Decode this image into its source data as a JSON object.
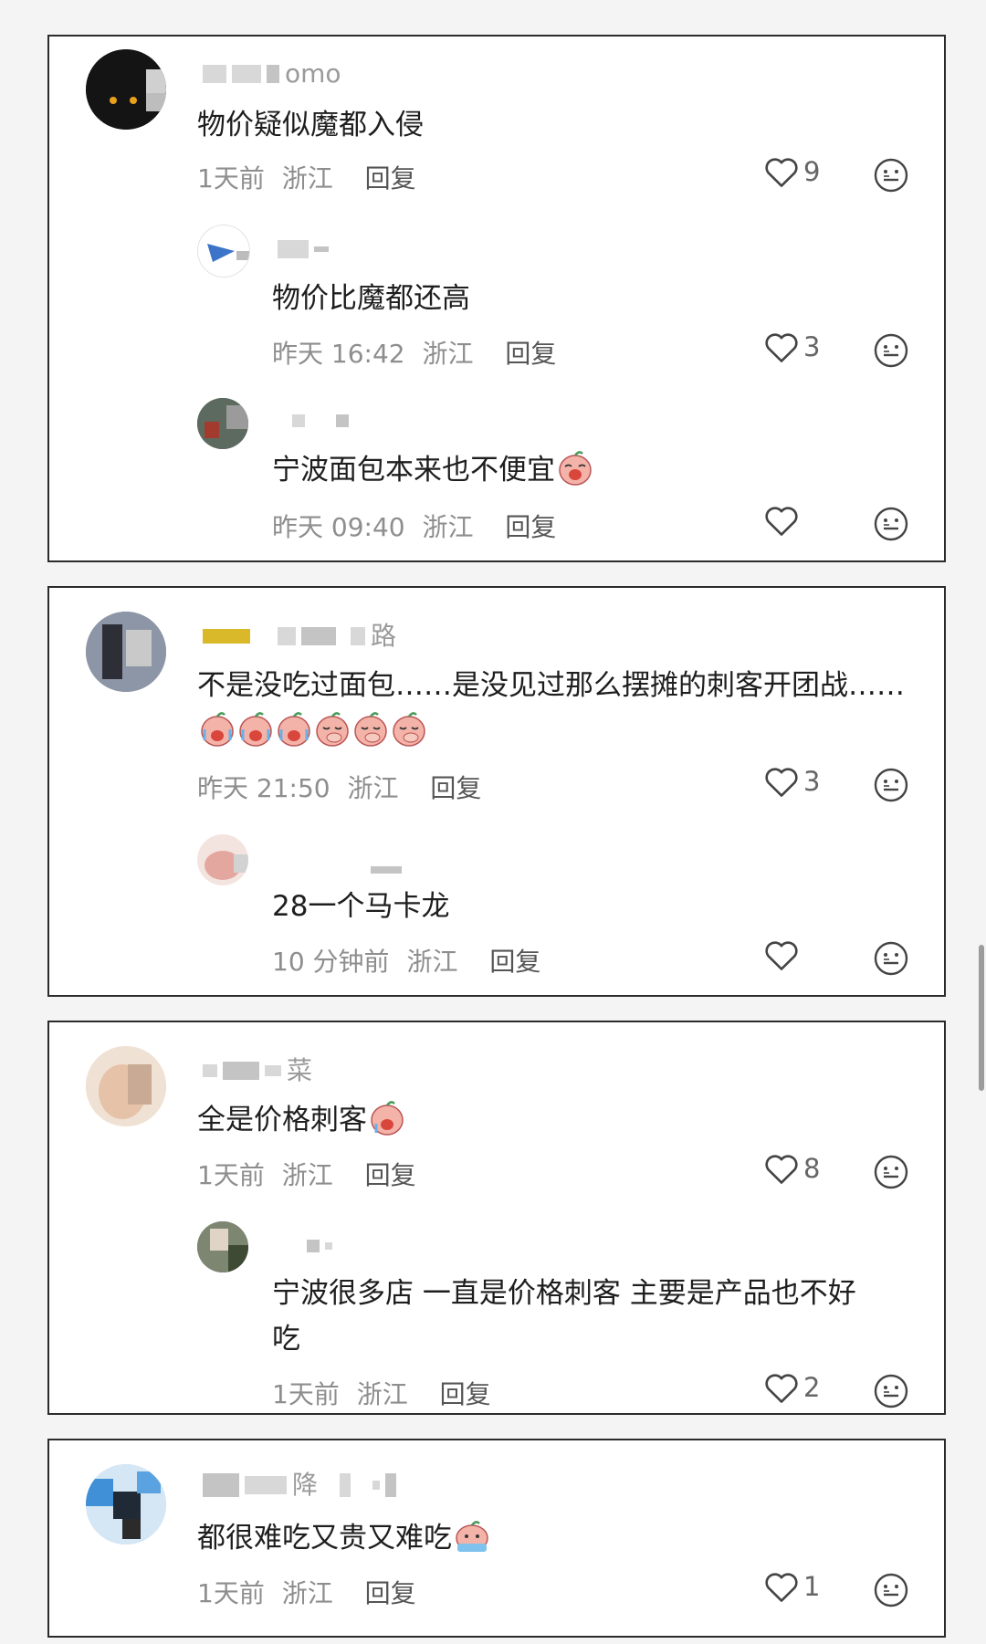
{
  "threads": [
    {
      "main": {
        "name_suffix": "omo",
        "text": "物价疑似魔都入侵",
        "time": "1天前",
        "region": "浙江",
        "reply_label": "回复",
        "likes": "9"
      },
      "replies": [
        {
          "name_suffix": "",
          "text": "物价比魔都还高",
          "time": "昨天 16:42",
          "region": "浙江",
          "reply_label": "回复",
          "likes": "3"
        },
        {
          "name_suffix": "",
          "text": "宁波面包本来也不便宜",
          "time": "昨天 09:40",
          "region": "浙江",
          "reply_label": "回复",
          "likes": ""
        }
      ]
    },
    {
      "main": {
        "name_suffix": "路",
        "text": "不是没吃过面包……是没见过那么摆摊的刺客开团战……",
        "time": "昨天 21:50",
        "region": "浙江",
        "reply_label": "回复",
        "likes": "3"
      },
      "replies": [
        {
          "name_suffix": "",
          "text": "28一个马卡龙",
          "time": "10 分钟前",
          "region": "浙江",
          "reply_label": "回复",
          "likes": ""
        }
      ]
    },
    {
      "main": {
        "name_suffix": "菜",
        "text": "全是价格刺客",
        "time": "1天前",
        "region": "浙江",
        "reply_label": "回复",
        "likes": "8"
      },
      "replies": [
        {
          "name_suffix": "",
          "text": "宁波很多店 一直是价格刺客 主要是产品也不好吃",
          "time": "1天前",
          "region": "浙江",
          "reply_label": "回复",
          "likes": "2"
        }
      ]
    },
    {
      "main": {
        "name_suffix": "降",
        "text": "都很难吃又贵又难吃",
        "time": "1天前",
        "region": "浙江",
        "reply_label": "回复",
        "likes": "1"
      },
      "replies": []
    }
  ],
  "icons": {
    "like": "heart-outline-icon",
    "emoji_reply": "neutral-face-icon",
    "sticker": "peach-crying-sticker"
  },
  "colors": {
    "card_border": "#2b2b2b",
    "meta_text": "#8e8e8e",
    "sticker_pink": "#f2a9a0"
  }
}
